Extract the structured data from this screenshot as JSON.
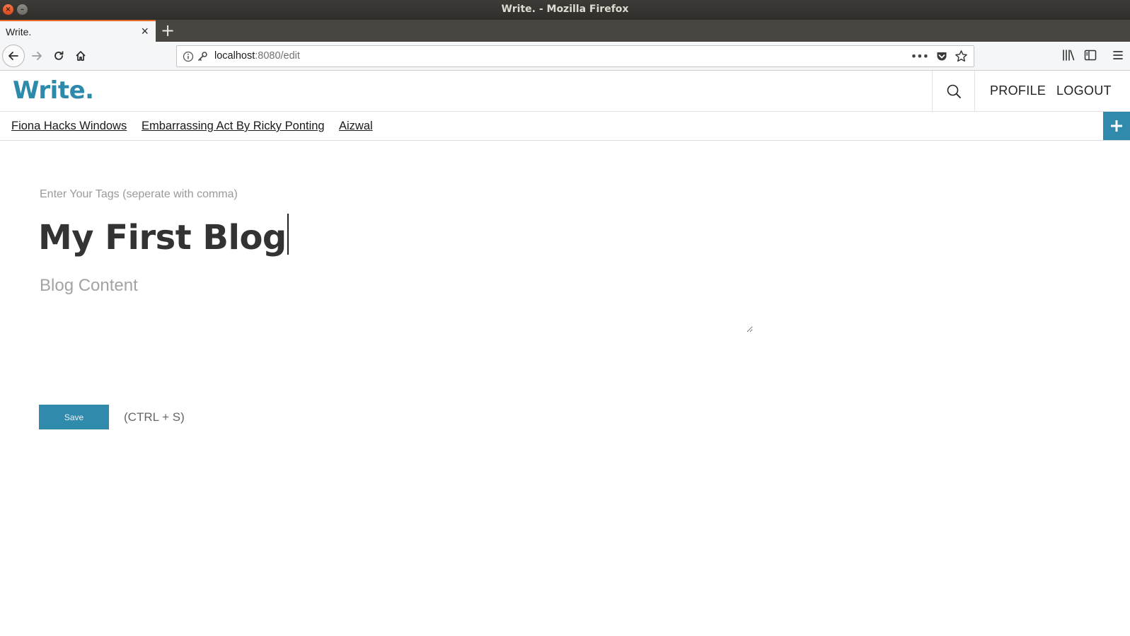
{
  "window": {
    "title": "Write. - Mozilla Firefox"
  },
  "browser": {
    "tab_title": "Write.",
    "url_host": "localhost",
    "url_rest": ":8080/edit",
    "url_more": "•••"
  },
  "header": {
    "logo": "Write.",
    "profile_label": "PROFILE",
    "logout_label": "LOGOUT"
  },
  "tagbar": {
    "links": [
      "Fiona Hacks Windows",
      "Embarrassing Act By Ricky Ponting",
      "Aizwal"
    ]
  },
  "editor": {
    "tags_placeholder": "Enter Your Tags (seperate with comma)",
    "tags_value": "",
    "title_value": "My First Blog",
    "content_placeholder": "Blog Content",
    "content_value": "",
    "save_label": "Save",
    "shortcut_hint": "(CTRL + S)"
  },
  "colors": {
    "brand": "#2e8aab",
    "tab_accent": "#e66a2c"
  },
  "icons": {
    "back": "back-arrow-icon",
    "forward": "forward-arrow-icon",
    "reload": "reload-icon",
    "home": "home-icon",
    "search": "search-icon",
    "add": "plus-icon"
  }
}
